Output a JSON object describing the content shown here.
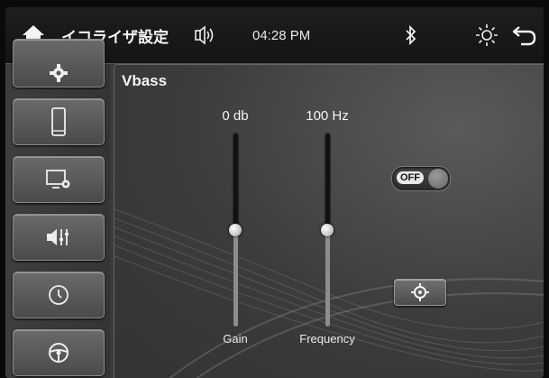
{
  "header": {
    "title": "イコライザ設定",
    "time": "04:28 PM",
    "icons": [
      "home-icon",
      "speaker-icon",
      "bluetooth-icon",
      "brightness-icon",
      "back-icon"
    ]
  },
  "sidebar": {
    "items": [
      {
        "icon": "gear-icon"
      },
      {
        "icon": "phone-icon"
      },
      {
        "icon": "display-settings-icon"
      },
      {
        "icon": "sound-settings-icon"
      },
      {
        "icon": "clock-icon"
      },
      {
        "icon": "steering-wheel-icon"
      }
    ]
  },
  "panel": {
    "title": "Vbass",
    "gain": {
      "label": "Gain",
      "value": "0 db",
      "level": 0.5
    },
    "frequency": {
      "label": "Frequency",
      "value": "100 Hz",
      "level": 0.5
    },
    "toggle": {
      "label": "OFF",
      "state": false
    },
    "target_icon": "target-icon"
  },
  "colors": {
    "background": "#3a3a3a",
    "topbar": "#1a1a1a",
    "button": "#5a5a5a",
    "text": "#f2f2f2"
  }
}
